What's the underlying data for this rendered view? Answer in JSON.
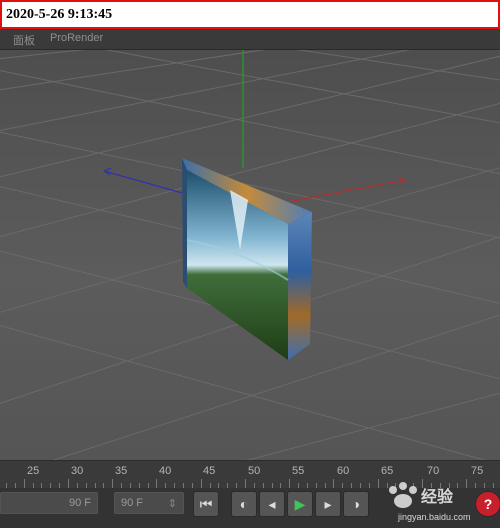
{
  "stamp": {
    "datetime": "2020-5-26 9:13:45"
  },
  "menu": {
    "items": [
      "面板",
      "ProRender"
    ]
  },
  "timeline": {
    "ticks": [
      "25",
      "30",
      "35",
      "40",
      "45",
      "50",
      "55",
      "60",
      "65",
      "70",
      "75"
    ]
  },
  "transport": {
    "start_field": "90 F",
    "end_field": "90 F"
  },
  "watermark": {
    "site": "jingyan.baidu.com",
    "logo_text": "Bai 经验"
  },
  "colors": {
    "x_axis": "#b03030",
    "y_axis": "#22a022",
    "z_axis": "#3030b0",
    "play": "#3fc35a",
    "stamp_border": "#e01010"
  }
}
